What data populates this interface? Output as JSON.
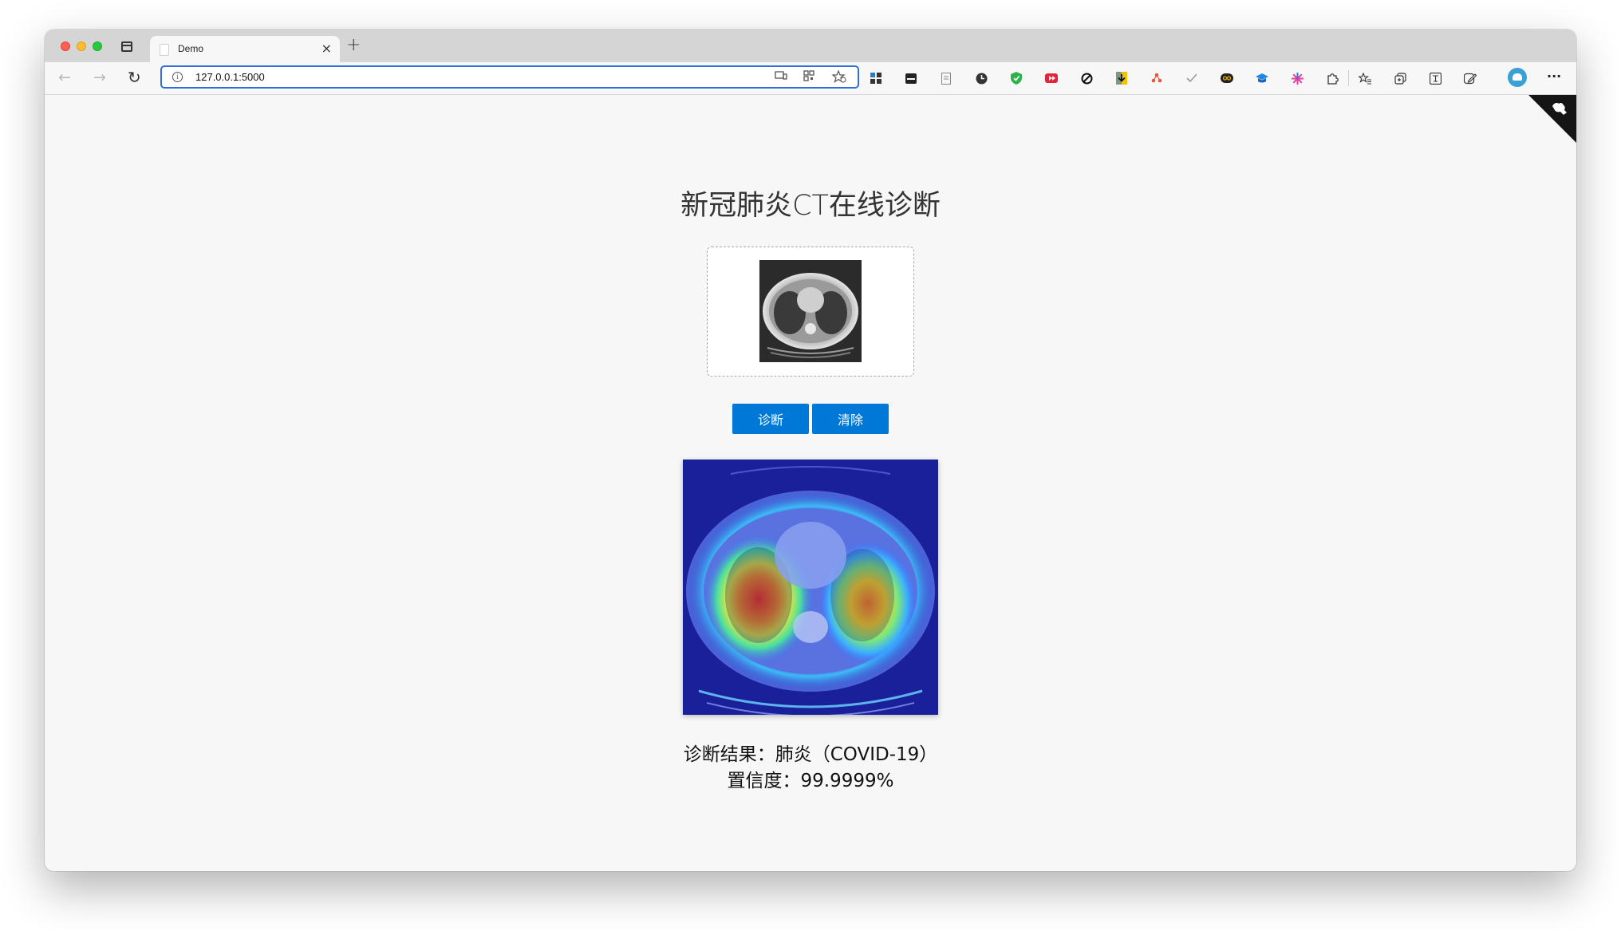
{
  "browser": {
    "tab_title": "Demo",
    "tab_close": "×",
    "new_tab": "+",
    "url": "127.0.0.1:5000",
    "nav": {
      "back": "←",
      "forward": "→",
      "reload": "↻"
    },
    "more": "···"
  },
  "extensions": [
    {
      "name": "apps-icon",
      "color": "#333333"
    },
    {
      "name": "inbox-icon",
      "color": "#222222"
    },
    {
      "name": "page-icon",
      "color": "#888888"
    },
    {
      "name": "clock-icon",
      "color": "#333333"
    },
    {
      "name": "shield-icon",
      "color": "#2fb24c"
    },
    {
      "name": "video-icon",
      "color": "#e0263a"
    },
    {
      "name": "block-icon",
      "color": "#111111"
    },
    {
      "name": "download-icon",
      "color": "#d99a00"
    },
    {
      "name": "tree-icon",
      "color": "#e8553a"
    },
    {
      "name": "check-icon",
      "color": "#999999"
    },
    {
      "name": "infinity-icon",
      "color": "#222222"
    },
    {
      "name": "graduation-icon",
      "color": "#1e88e5"
    },
    {
      "name": "sparkle-icon",
      "color": "#e53e9e"
    },
    {
      "name": "puzzle-icon",
      "color": "#333333"
    },
    {
      "name": "favorites-icon",
      "color": "#333333"
    },
    {
      "name": "collections-icon",
      "color": "#333333"
    },
    {
      "name": "translate-icon",
      "color": "#333333"
    },
    {
      "name": "feedback-icon",
      "color": "#333333"
    }
  ],
  "page": {
    "title": "新冠肺炎CT在线诊断",
    "buttons": {
      "diagnose": "诊断",
      "clear": "清除"
    },
    "result_line": "诊断结果：肺炎（COVID-19）",
    "confidence_line": "置信度：99.9999%"
  }
}
